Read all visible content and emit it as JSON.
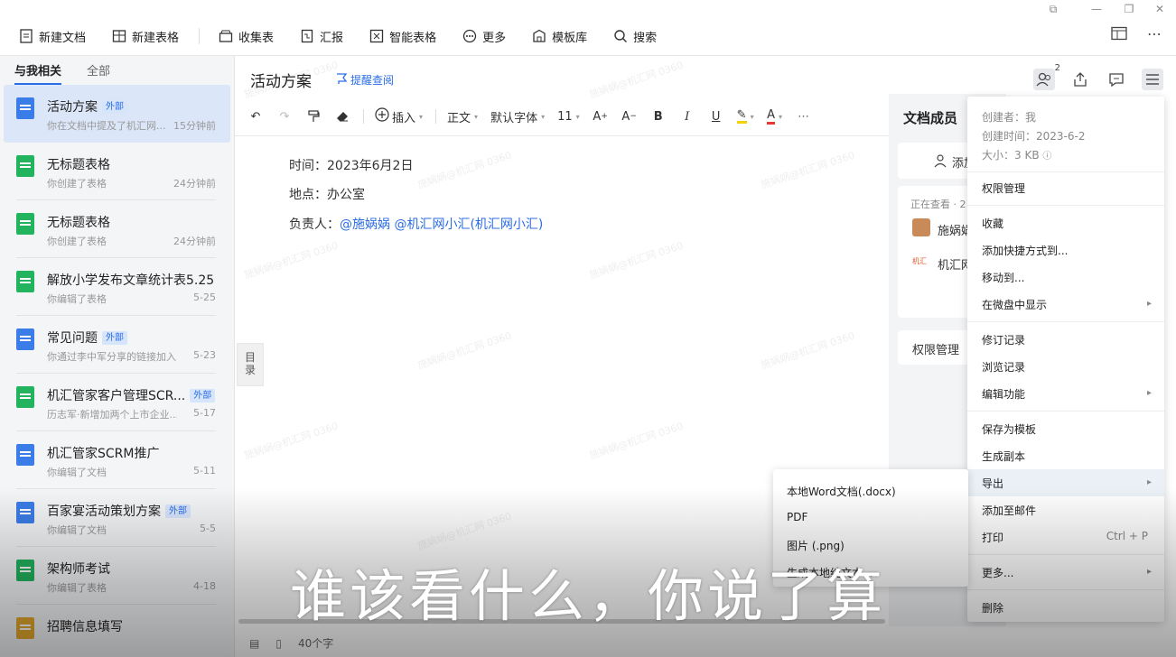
{
  "toolbar": {
    "items": [
      {
        "label": "新建文档",
        "icon": "new-doc-icon"
      },
      {
        "label": "新建表格",
        "icon": "new-sheet-icon"
      },
      {
        "label": "收集表",
        "icon": "collect-form-icon"
      },
      {
        "label": "汇报",
        "icon": "report-icon"
      },
      {
        "label": "智能表格",
        "icon": "smart-sheet-icon"
      },
      {
        "label": "更多",
        "icon": "more-circle-icon"
      },
      {
        "label": "模板库",
        "icon": "template-icon"
      },
      {
        "label": "搜索",
        "icon": "search-icon"
      }
    ]
  },
  "sidebar": {
    "tabs": [
      "与我相关",
      "全部"
    ],
    "items": [
      {
        "name": "活动方案",
        "badge": "外部",
        "sub": "你在文档中提及了机汇网...",
        "time": "15分钟前",
        "type": "doc"
      },
      {
        "name": "无标题表格",
        "badge": "",
        "sub": "你创建了表格",
        "time": "24分钟前",
        "type": "sheet"
      },
      {
        "name": "无标题表格",
        "badge": "",
        "sub": "你创建了表格",
        "time": "24分钟前",
        "type": "sheet"
      },
      {
        "name": "解放小学发布文章统计表5.25",
        "badge": "",
        "sub": "你编辑了表格",
        "time": "5-25",
        "type": "sheet"
      },
      {
        "name": "常见问题",
        "badge": "外部",
        "sub": "你通过李中军分享的链接加入...",
        "time": "5-23",
        "type": "doc"
      },
      {
        "name": "机汇管家客户管理SCR...",
        "badge": "外部",
        "sub": "历志军·新增加两个上市企业...",
        "time": "5-17",
        "type": "sheet"
      },
      {
        "name": "机汇管家SCRM推广",
        "badge": "",
        "sub": "你编辑了文档",
        "time": "5-11",
        "type": "doc"
      },
      {
        "name": "百家宴活动策划方案",
        "badge": "外部",
        "sub": "你编辑了文档",
        "time": "5-5",
        "type": "doc"
      },
      {
        "name": "架构师考试",
        "badge": "",
        "sub": "你编辑了表格",
        "time": "4-18",
        "type": "sheet"
      },
      {
        "name": "招聘信息填写",
        "badge": "",
        "sub": "",
        "time": "",
        "type": "form"
      }
    ]
  },
  "document": {
    "title": "活动方案",
    "remind": "提醒查阅",
    "toc": "目录",
    "lines": {
      "time": "时间：2023年6月2日",
      "place": "地点：办公室",
      "owner_label": "负责人：",
      "owner_mentions": "@施娲娲 @机汇网小汇(机汇网小汇)"
    },
    "watermark": "施娲娲@机汇网 0360"
  },
  "format_bar": {
    "insert": "插入",
    "style": "正文",
    "font": "默认字体",
    "size": "11"
  },
  "members": {
    "title": "文档成员",
    "add": "添加",
    "viewing": "正在查看 · 2",
    "user1": "施娲娲",
    "user2": "机汇网",
    "permission": "权限管理",
    "count": "2"
  },
  "menu": {
    "creator": "创建者：我",
    "created": "创建时间：2023-6-2",
    "size": "大小：3 KB",
    "permission": "权限管理",
    "favorite": "收藏",
    "shortcut": "添加快捷方式到...",
    "move": "移动到...",
    "show_in_drive": "在微盘中显示",
    "revisions": "修订记录",
    "browse_history": "浏览记录",
    "edit_features": "编辑功能",
    "save_template": "保存为模板",
    "make_copy": "生成副本",
    "export": "导出",
    "add_mail": "添加至邮件",
    "print": "打印",
    "print_shortcut": "Ctrl + P",
    "more": "更多...",
    "delete": "删除"
  },
  "export_menu": {
    "word": "本地Word文档(.docx)",
    "pdf": "PDF",
    "image": "图片 (.png)",
    "other": "生成本地纯文本..."
  },
  "status": {
    "word_count": "40个字"
  },
  "subtitle": "谁该看什么，你说了算",
  "colors": {
    "accent": "#2b6de5",
    "doc_icon": "#3b7de8",
    "sheet_icon": "#22b35e",
    "form_icon": "#e3a92e"
  }
}
